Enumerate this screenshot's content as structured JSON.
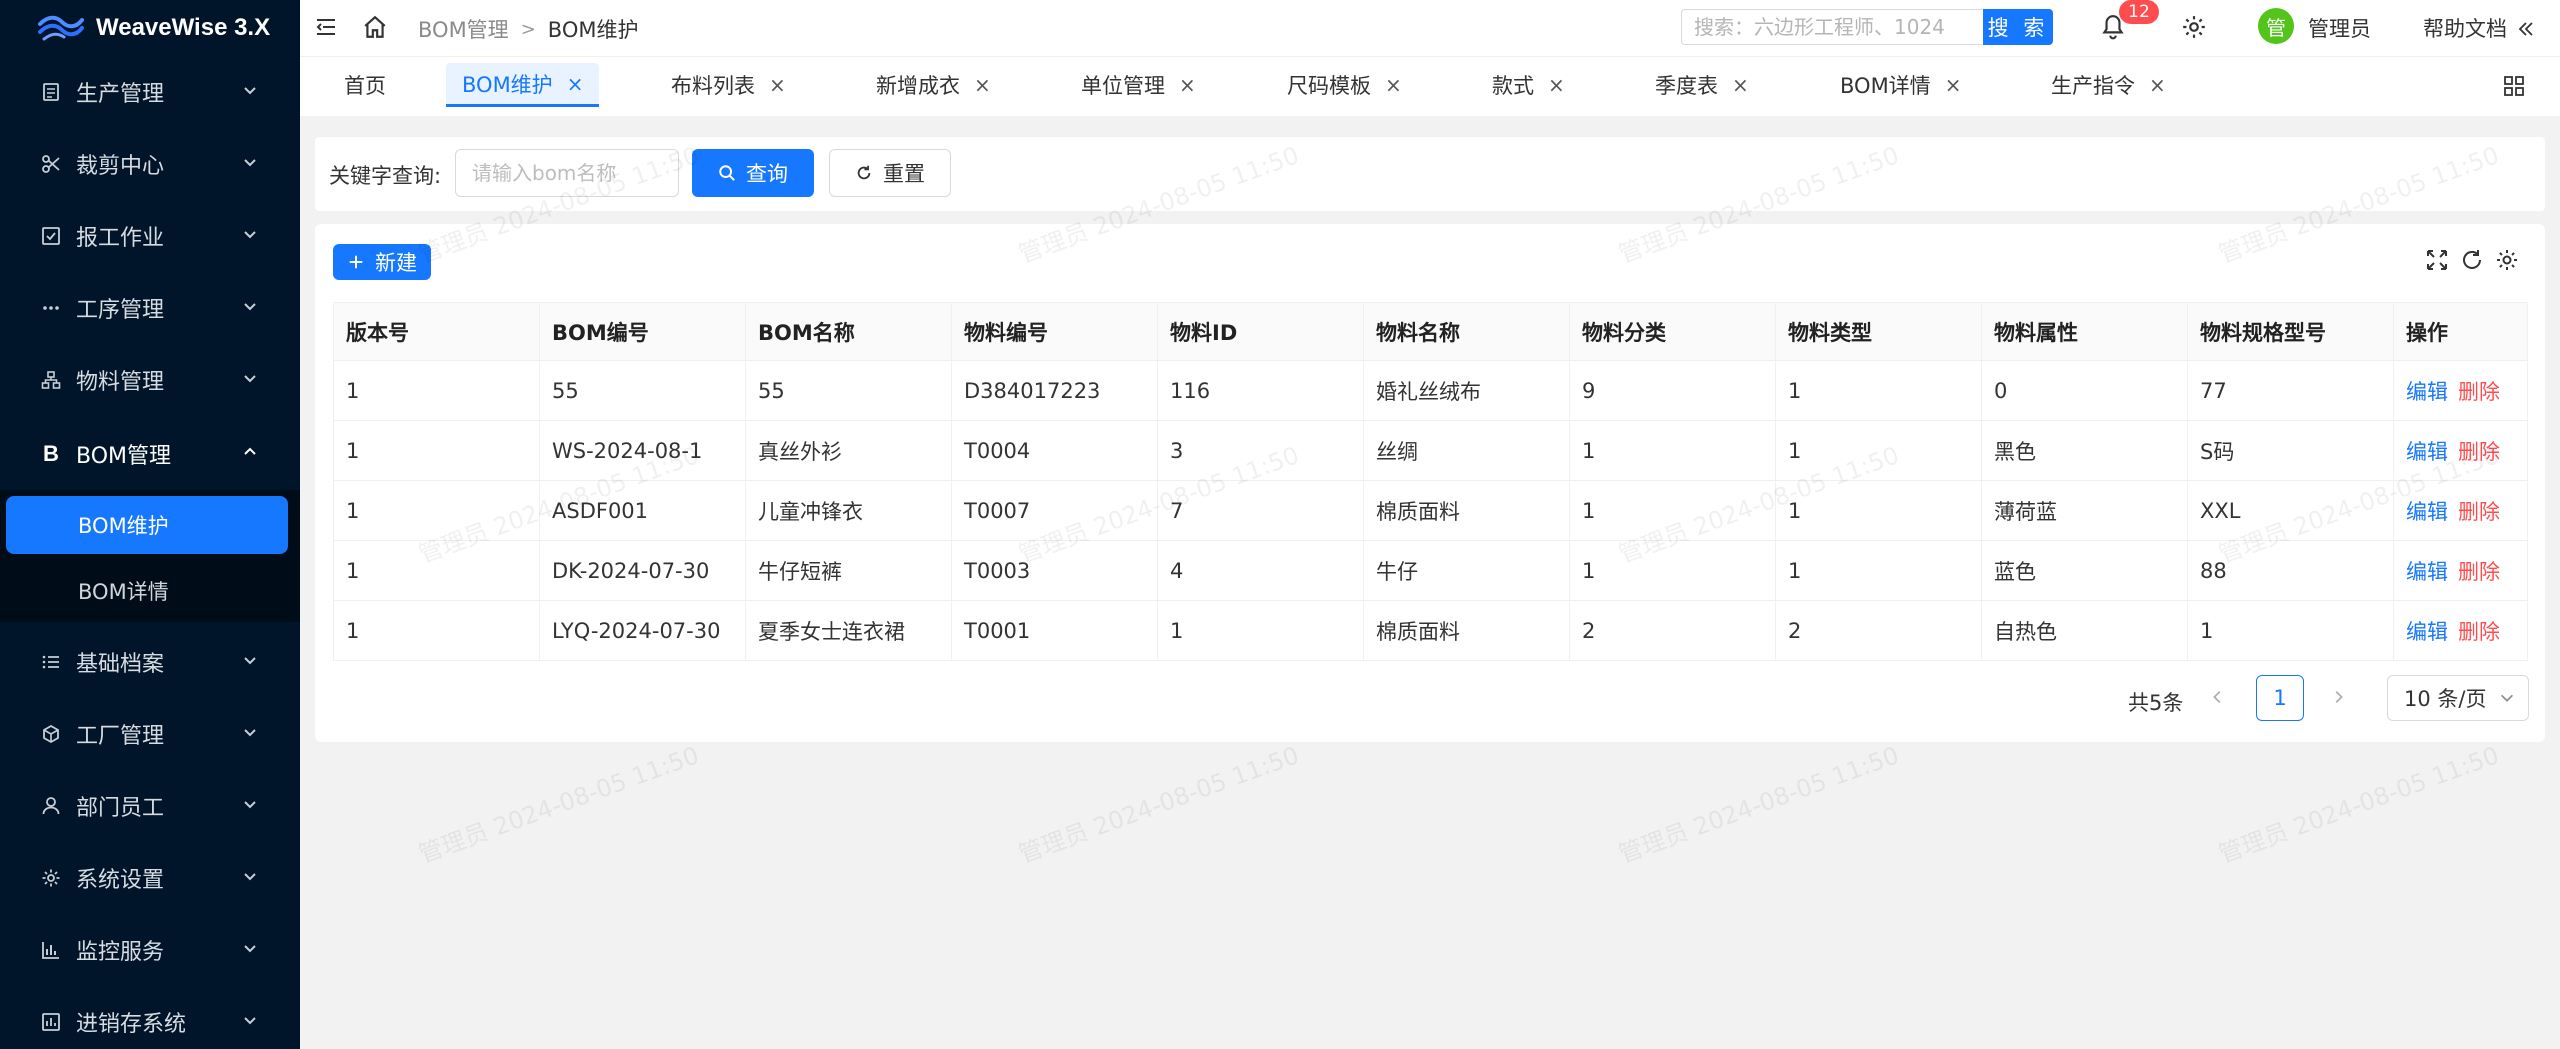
{
  "app": {
    "name": "WeaveWise 3.X"
  },
  "sidebar": {
    "items": [
      {
        "label": "生产管理",
        "icon": "production-icon"
      },
      {
        "label": "裁剪中心",
        "icon": "scissors-icon"
      },
      {
        "label": "报工作业",
        "icon": "checklist-icon"
      },
      {
        "label": "工序管理",
        "icon": "dots-icon"
      },
      {
        "label": "物料管理",
        "icon": "hierarchy-icon"
      },
      {
        "label": "BOM管理",
        "icon": "bom-b-icon",
        "expanded": true
      },
      {
        "label": "基础档案",
        "icon": "list-icon"
      },
      {
        "label": "工厂管理",
        "icon": "factory-cube-icon"
      },
      {
        "label": "部门员工",
        "icon": "user-icon"
      },
      {
        "label": "系统设置",
        "icon": "gear-icon"
      },
      {
        "label": "监控服务",
        "icon": "bar-chart-icon"
      },
      {
        "label": "进销存系统",
        "icon": "inventory-icon"
      }
    ],
    "submenu": [
      {
        "label": "BOM维护",
        "active": true
      },
      {
        "label": "BOM详情",
        "active": false
      }
    ]
  },
  "header": {
    "breadcrumb": [
      "BOM管理",
      "BOM维护"
    ],
    "breadcrumb_sep": ">",
    "search_placeholder": "搜索：六边形工程师、1024",
    "search_button": "搜 索",
    "notification_count": "12",
    "user_avatar_text": "管",
    "user_name": "管理员",
    "help_label": "帮助文档"
  },
  "tabs": [
    {
      "label": "首页",
      "closable": false
    },
    {
      "label": "BOM维护",
      "closable": true,
      "active": true
    },
    {
      "label": "布料列表",
      "closable": true
    },
    {
      "label": "新增成衣",
      "closable": true
    },
    {
      "label": "单位管理",
      "closable": true
    },
    {
      "label": "尺码模板",
      "closable": true
    },
    {
      "label": "款式",
      "closable": true
    },
    {
      "label": "季度表",
      "closable": true
    },
    {
      "label": "BOM详情",
      "closable": true
    },
    {
      "label": "生产指令",
      "closable": true
    }
  ],
  "tab_close_glyph": "×",
  "filter": {
    "label": "关键字查询:",
    "placeholder": "请输入bom名称",
    "value": "",
    "query_button": "查询",
    "reset_button": "重置"
  },
  "toolbar": {
    "new_button": "新建"
  },
  "table": {
    "columns": [
      "版本号",
      "BOM编号",
      "BOM名称",
      "物料编号",
      "物料ID",
      "物料名称",
      "物料分类",
      "物料类型",
      "物料属性",
      "物料规格型号",
      "操作"
    ],
    "rows": [
      [
        "1",
        "55",
        "55",
        "D384017223",
        "116",
        "婚礼丝绒布",
        "9",
        "1",
        "0",
        "77"
      ],
      [
        "1",
        "WS-2024-08-1",
        "真丝外衫",
        "T0004",
        "3",
        "丝绸",
        "1",
        "1",
        "黑色",
        "S码"
      ],
      [
        "1",
        "ASDF001",
        "儿童冲锋衣",
        "T0007",
        "7",
        "棉质面料",
        "1",
        "1",
        "薄荷蓝",
        "XXL"
      ],
      [
        "1",
        "DK-2024-07-30",
        "牛仔短裤",
        "T0003",
        "4",
        "牛仔",
        "1",
        "1",
        "蓝色",
        "88"
      ],
      [
        "1",
        "LYQ-2024-07-30",
        "夏季女士连衣裙",
        "T0001",
        "1",
        "棉质面料",
        "2",
        "2",
        "自热色",
        "1"
      ]
    ],
    "actions": {
      "edit": "编辑",
      "delete": "删除"
    }
  },
  "pagination": {
    "total_text": "共5条",
    "current_page": "1",
    "page_size": "10 条/页"
  },
  "watermark": "管理员 2024-08-05 11:50",
  "colors": {
    "primary": "#1677ff",
    "danger": "#ff4d4f",
    "sidebar_bg": "#001529",
    "success_avatar": "#52c41a"
  }
}
